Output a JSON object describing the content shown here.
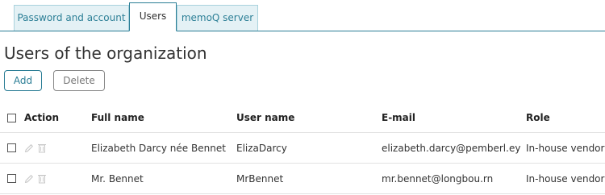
{
  "tabs": [
    {
      "label": "Password and account",
      "active": false
    },
    {
      "label": "Users",
      "active": true
    },
    {
      "label": "memoQ server",
      "active": false
    }
  ],
  "page_title": "Users of the organization",
  "buttons": {
    "add": "Add",
    "delete": "Delete"
  },
  "table": {
    "headers": {
      "action": "Action",
      "full_name": "Full name",
      "user_name": "User name",
      "email": "E-mail",
      "role": "Role"
    },
    "rows": [
      {
        "full_name": "Elizabeth Darcy née Bennet",
        "user_name": "ElizaDarcy",
        "email": "elizabeth.darcy@pemberl.ey",
        "role": "In-house vendor"
      },
      {
        "full_name": "Mr. Bennet",
        "user_name": "MrBennet",
        "email": "mr.bennet@longbou.rn",
        "role": "In-house vendor"
      }
    ]
  },
  "icons": {
    "edit": "pencil-icon",
    "delete": "trash-icon"
  },
  "colors": {
    "accent": "#2a7d95",
    "tab_inactive_bg": "#e4f1f5",
    "icon_gray": "#c8c8c8"
  }
}
